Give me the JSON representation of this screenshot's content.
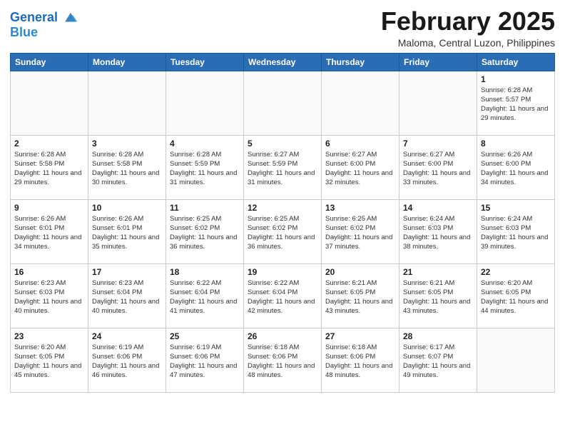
{
  "header": {
    "logo_line1": "General",
    "logo_line2": "Blue",
    "month": "February 2025",
    "location": "Maloma, Central Luzon, Philippines"
  },
  "weekdays": [
    "Sunday",
    "Monday",
    "Tuesday",
    "Wednesday",
    "Thursday",
    "Friday",
    "Saturday"
  ],
  "weeks": [
    [
      {
        "day": "",
        "info": ""
      },
      {
        "day": "",
        "info": ""
      },
      {
        "day": "",
        "info": ""
      },
      {
        "day": "",
        "info": ""
      },
      {
        "day": "",
        "info": ""
      },
      {
        "day": "",
        "info": ""
      },
      {
        "day": "1",
        "info": "Sunrise: 6:28 AM\nSunset: 5:57 PM\nDaylight: 11 hours and 29 minutes."
      }
    ],
    [
      {
        "day": "2",
        "info": "Sunrise: 6:28 AM\nSunset: 5:58 PM\nDaylight: 11 hours and 29 minutes."
      },
      {
        "day": "3",
        "info": "Sunrise: 6:28 AM\nSunset: 5:58 PM\nDaylight: 11 hours and 30 minutes."
      },
      {
        "day": "4",
        "info": "Sunrise: 6:28 AM\nSunset: 5:59 PM\nDaylight: 11 hours and 31 minutes."
      },
      {
        "day": "5",
        "info": "Sunrise: 6:27 AM\nSunset: 5:59 PM\nDaylight: 11 hours and 31 minutes."
      },
      {
        "day": "6",
        "info": "Sunrise: 6:27 AM\nSunset: 6:00 PM\nDaylight: 11 hours and 32 minutes."
      },
      {
        "day": "7",
        "info": "Sunrise: 6:27 AM\nSunset: 6:00 PM\nDaylight: 11 hours and 33 minutes."
      },
      {
        "day": "8",
        "info": "Sunrise: 6:26 AM\nSunset: 6:00 PM\nDaylight: 11 hours and 34 minutes."
      }
    ],
    [
      {
        "day": "9",
        "info": "Sunrise: 6:26 AM\nSunset: 6:01 PM\nDaylight: 11 hours and 34 minutes."
      },
      {
        "day": "10",
        "info": "Sunrise: 6:26 AM\nSunset: 6:01 PM\nDaylight: 11 hours and 35 minutes."
      },
      {
        "day": "11",
        "info": "Sunrise: 6:25 AM\nSunset: 6:02 PM\nDaylight: 11 hours and 36 minutes."
      },
      {
        "day": "12",
        "info": "Sunrise: 6:25 AM\nSunset: 6:02 PM\nDaylight: 11 hours and 36 minutes."
      },
      {
        "day": "13",
        "info": "Sunrise: 6:25 AM\nSunset: 6:02 PM\nDaylight: 11 hours and 37 minutes."
      },
      {
        "day": "14",
        "info": "Sunrise: 6:24 AM\nSunset: 6:03 PM\nDaylight: 11 hours and 38 minutes."
      },
      {
        "day": "15",
        "info": "Sunrise: 6:24 AM\nSunset: 6:03 PM\nDaylight: 11 hours and 39 minutes."
      }
    ],
    [
      {
        "day": "16",
        "info": "Sunrise: 6:23 AM\nSunset: 6:03 PM\nDaylight: 11 hours and 40 minutes."
      },
      {
        "day": "17",
        "info": "Sunrise: 6:23 AM\nSunset: 6:04 PM\nDaylight: 11 hours and 40 minutes."
      },
      {
        "day": "18",
        "info": "Sunrise: 6:22 AM\nSunset: 6:04 PM\nDaylight: 11 hours and 41 minutes."
      },
      {
        "day": "19",
        "info": "Sunrise: 6:22 AM\nSunset: 6:04 PM\nDaylight: 11 hours and 42 minutes."
      },
      {
        "day": "20",
        "info": "Sunrise: 6:21 AM\nSunset: 6:05 PM\nDaylight: 11 hours and 43 minutes."
      },
      {
        "day": "21",
        "info": "Sunrise: 6:21 AM\nSunset: 6:05 PM\nDaylight: 11 hours and 43 minutes."
      },
      {
        "day": "22",
        "info": "Sunrise: 6:20 AM\nSunset: 6:05 PM\nDaylight: 11 hours and 44 minutes."
      }
    ],
    [
      {
        "day": "23",
        "info": "Sunrise: 6:20 AM\nSunset: 6:05 PM\nDaylight: 11 hours and 45 minutes."
      },
      {
        "day": "24",
        "info": "Sunrise: 6:19 AM\nSunset: 6:06 PM\nDaylight: 11 hours and 46 minutes."
      },
      {
        "day": "25",
        "info": "Sunrise: 6:19 AM\nSunset: 6:06 PM\nDaylight: 11 hours and 47 minutes."
      },
      {
        "day": "26",
        "info": "Sunrise: 6:18 AM\nSunset: 6:06 PM\nDaylight: 11 hours and 48 minutes."
      },
      {
        "day": "27",
        "info": "Sunrise: 6:18 AM\nSunset: 6:06 PM\nDaylight: 11 hours and 48 minutes."
      },
      {
        "day": "28",
        "info": "Sunrise: 6:17 AM\nSunset: 6:07 PM\nDaylight: 11 hours and 49 minutes."
      },
      {
        "day": "",
        "info": ""
      }
    ]
  ]
}
